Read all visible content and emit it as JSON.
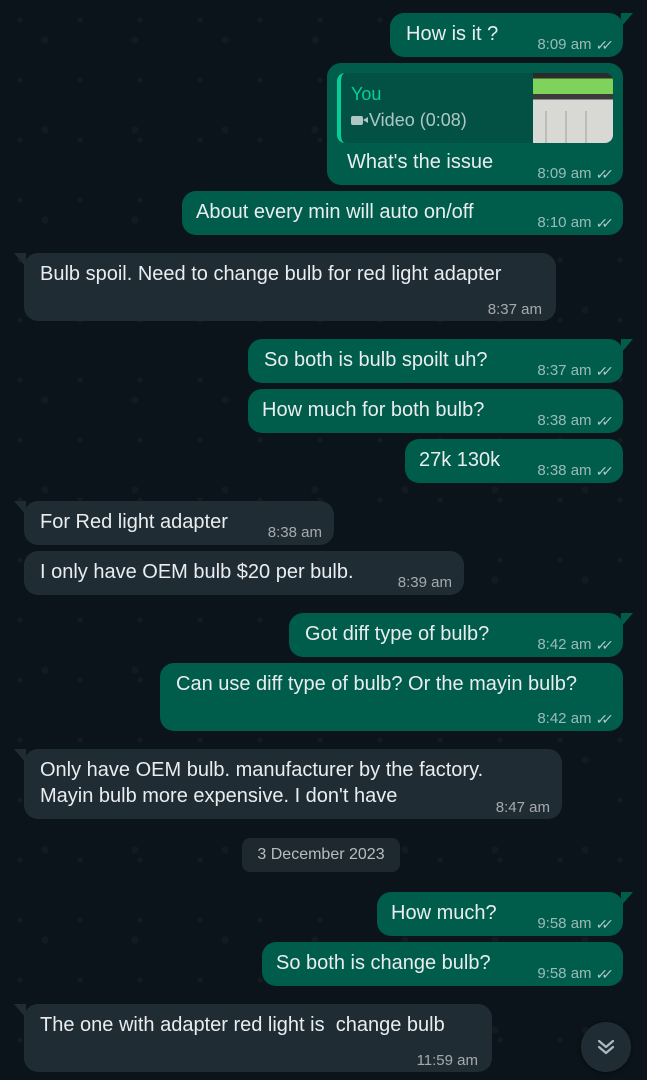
{
  "messages": [
    {
      "dir": "out",
      "text": "How is it ?",
      "time": "8:09 am"
    },
    {
      "dir": "out",
      "quote": {
        "author": "You",
        "media": "Video (0:08)",
        "icon": "video-camera-icon"
      },
      "text": "What's the issue",
      "time": "8:09 am"
    },
    {
      "dir": "out",
      "text": "About every min will auto on/off",
      "time": "8:10 am"
    },
    {
      "dir": "in",
      "text": "Bulb spoil. Need to change bulb for red light adapter",
      "time": "8:37 am"
    },
    {
      "dir": "out",
      "text": "So both is bulb spoilt uh?",
      "time": "8:37 am"
    },
    {
      "dir": "out",
      "text": "How much for both bulb?",
      "time": "8:38 am"
    },
    {
      "dir": "out",
      "text": "27k 130k",
      "time": "8:38 am"
    },
    {
      "dir": "in",
      "text": "For Red light adapter",
      "time": "8:38 am"
    },
    {
      "dir": "in",
      "text": "I only have OEM bulb $20 per bulb.",
      "time": "8:39 am"
    },
    {
      "dir": "out",
      "text": "Got diff type of bulb?",
      "time": "8:42 am"
    },
    {
      "dir": "out",
      "text": "Can use diff type of bulb? Or the mayin bulb?",
      "time": "8:42 am"
    },
    {
      "dir": "in",
      "text_lines": [
        "Only have OEM bulb. manufacturer by the factory.",
        "Mayin bulb more expensive. I don't have"
      ],
      "time": "8:47 am"
    },
    {
      "dir": "out",
      "text": "How much?",
      "time": "9:58 am"
    },
    {
      "dir": "out",
      "text": "So both is change bulb?",
      "time": "9:58 am"
    },
    {
      "dir": "in",
      "text": "The one with adapter red light is  change bulb",
      "time": "11:59 am"
    }
  ],
  "date_divider": "3 December 2023",
  "read_receipt": "double-check-icon",
  "scroll_button": {
    "icon": "chevron-double-down-icon"
  },
  "colors": {
    "background": "#0b141a",
    "outgoing": "#005c4b",
    "incoming": "#202c33",
    "accent": "#06cf9c"
  }
}
